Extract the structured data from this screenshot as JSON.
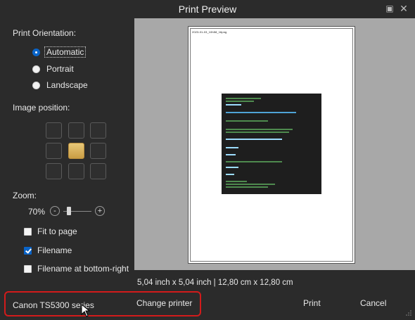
{
  "window": {
    "title": "Print Preview",
    "maximize_icon": "maximize-icon",
    "close_icon": "close-icon"
  },
  "orientation": {
    "label": "Print Orientation:",
    "options": [
      {
        "label": "Automatic",
        "selected": true
      },
      {
        "label": "Portrait",
        "selected": false
      },
      {
        "label": "Landscape",
        "selected": false
      }
    ]
  },
  "position": {
    "label": "Image position:",
    "selected": "middle-center"
  },
  "zoom": {
    "label": "Zoom:",
    "value": "70%",
    "minus": "-",
    "plus": "+"
  },
  "options": {
    "fit_to_page": {
      "label": "Fit to page",
      "checked": false
    },
    "filename": {
      "label": "Filename",
      "checked": true
    },
    "filename_bottom_right": {
      "label": "Filename at bottom-right",
      "checked": false
    }
  },
  "preview": {
    "filename_text": "2023-01-03_10h58_16png",
    "dimensions": "5,04 inch x 5,04 inch | 12,80 cm x 12,80 cm"
  },
  "footer": {
    "printer": "Canon TS5300 series",
    "change_printer": "Change printer",
    "print": "Print",
    "cancel": "Cancel",
    "highlight_color": "#d21b1b"
  }
}
